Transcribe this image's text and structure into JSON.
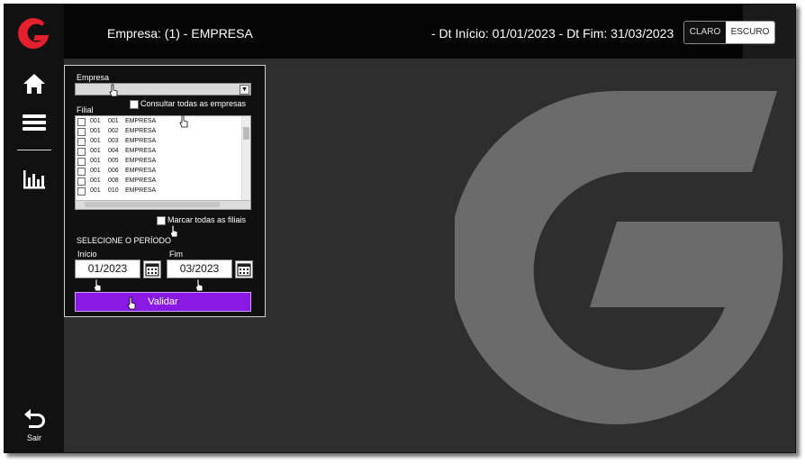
{
  "header": {
    "empresa_text": "Empresa: (1) -  EMPRESA",
    "period_text": "- Dt Início: 01/01/2023 - Dt Fim: 31/03/2023"
  },
  "theme": {
    "light_label": "CLARO",
    "dark_label": "ESCURO",
    "selected": "ESCURO"
  },
  "sidebar": {
    "items": [
      {
        "name": "home",
        "icon": "home-icon"
      },
      {
        "name": "menu",
        "icon": "hamburger-menu-icon"
      },
      {
        "name": "reports",
        "icon": "bar-chart-icon"
      }
    ],
    "exit_label": "Sair"
  },
  "form": {
    "empresa_label": "Empresa",
    "empresa_value": "",
    "consultar_todas_label": "Consultar todas as empresas",
    "filial_label": "Filial",
    "filiais": [
      {
        "col1": "001",
        "col2": "001",
        "name": "EMPRESA"
      },
      {
        "col1": "001",
        "col2": "002",
        "name": "EMPRESA"
      },
      {
        "col1": "001",
        "col2": "003",
        "name": "EMPRESA"
      },
      {
        "col1": "001",
        "col2": "004",
        "name": "EMPRESA"
      },
      {
        "col1": "001",
        "col2": "005",
        "name": "EMPRESA"
      },
      {
        "col1": "001",
        "col2": "006",
        "name": "EMPRESA"
      },
      {
        "col1": "001",
        "col2": "008",
        "name": "EMPRESA"
      },
      {
        "col1": "001",
        "col2": "010",
        "name": "EMPRESA"
      }
    ],
    "marcar_todas_label": "Marcar todas as filiais",
    "period_title": "SELECIONE O PERÍODO",
    "inicio_label": "Início",
    "inicio_value": "01/2023",
    "fim_label": "Fim",
    "fim_value": "03/2023",
    "validate_label": "Validar"
  },
  "colors": {
    "accent": "#8a19e6",
    "brand_red": "#e5202e",
    "background": "#2e2e2e"
  }
}
